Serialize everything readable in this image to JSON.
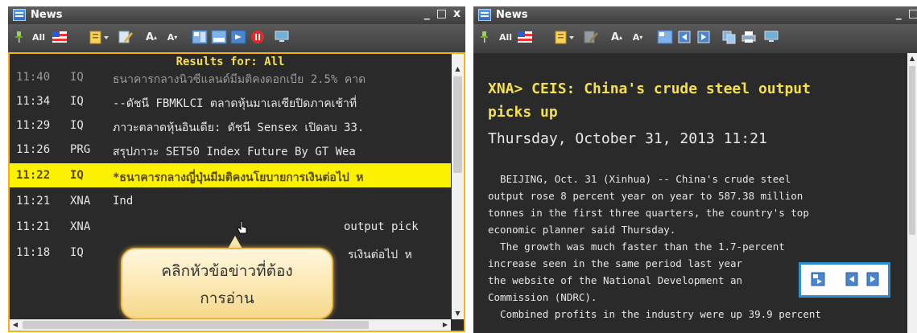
{
  "left_window": {
    "title": "News",
    "controls": [
      "_",
      "□",
      "x"
    ],
    "toolbar": {
      "all_label": "All",
      "font_larger": "A",
      "font_smaller": "A"
    },
    "results_header": "Results for: All",
    "rows": [
      {
        "time": "11:40",
        "code": "IQ",
        "headline": "ธนาคารกลางนิวซีแลนด์มีมติคงดอกเบีย 2.5% คาด"
      },
      {
        "time": "11:34",
        "code": "IQ",
        "headline": "--ดัชนี FBMKLCI ตลาดหุ้นมาเลเซียปิดภาคเช้าที่"
      },
      {
        "time": "11:29",
        "code": "IQ",
        "headline": "ภาวะตลาดหุ้นอินเดีย: ดัชนี Sensex เปิดลบ 33."
      },
      {
        "time": "11:26",
        "code": "PRG",
        "headline": "สรุปภาวะ SET50 Index Future  By GT Wea"
      },
      {
        "time": "11:22",
        "code": "IQ",
        "headline": "*ธนาคารกลางญี่ปุ่นมีมติคงนโยบายการเงินต่อไป ห"
      },
      {
        "time": "11:21",
        "code": "XNA",
        "headline": "Ind"
      },
      {
        "time": "11:21",
        "code": "XNA",
        "headline": "output pick"
      },
      {
        "time": "11:18",
        "code": "IQ",
        "headline": "รเงินต่อไป ห"
      }
    ],
    "callout": {
      "line1": "คลิกหัวข้อข่าวที่ต้อง",
      "line2": "การอ่าน"
    }
  },
  "right_window": {
    "title": "News",
    "controls": [
      "_",
      "□"
    ],
    "toolbar": {
      "all_label": "All",
      "font_larger": "A",
      "font_smaller": "A"
    },
    "article": {
      "headline_line1": "XNA>  CEIS: China's crude steel output",
      "headline_line2": "picks up",
      "date": "Thursday, October 31, 2013 11:21",
      "body": "  BEIJING, Oct. 31 (Xinhua) -- China's crude steel\noutput rose 8 percent year on year to 587.38 million\ntonnes in the first three quarters, the country's top\neconomic planner said Thursday.\n  The growth was much faster than the 1.7-percent\nincrease seen in the same period last year\nthe website of the National Development an\nCommission (NDRC).\n  Combined profits in the industry were up 39.9 percent"
    }
  },
  "colors": {
    "selected_row": "#fbf100",
    "header_text": "#f4e04d",
    "callout_border": "#e9b44c",
    "float_border": "#2b8fd0"
  },
  "icons": [
    "pin-icon",
    "flag-icon",
    "notepad-icon",
    "edit-icon",
    "font-larger-icon",
    "font-smaller-icon",
    "layout-icon",
    "alert-icon",
    "monitor-icon",
    "print-icon",
    "copy-icon",
    "hand-cursor-icon"
  ]
}
